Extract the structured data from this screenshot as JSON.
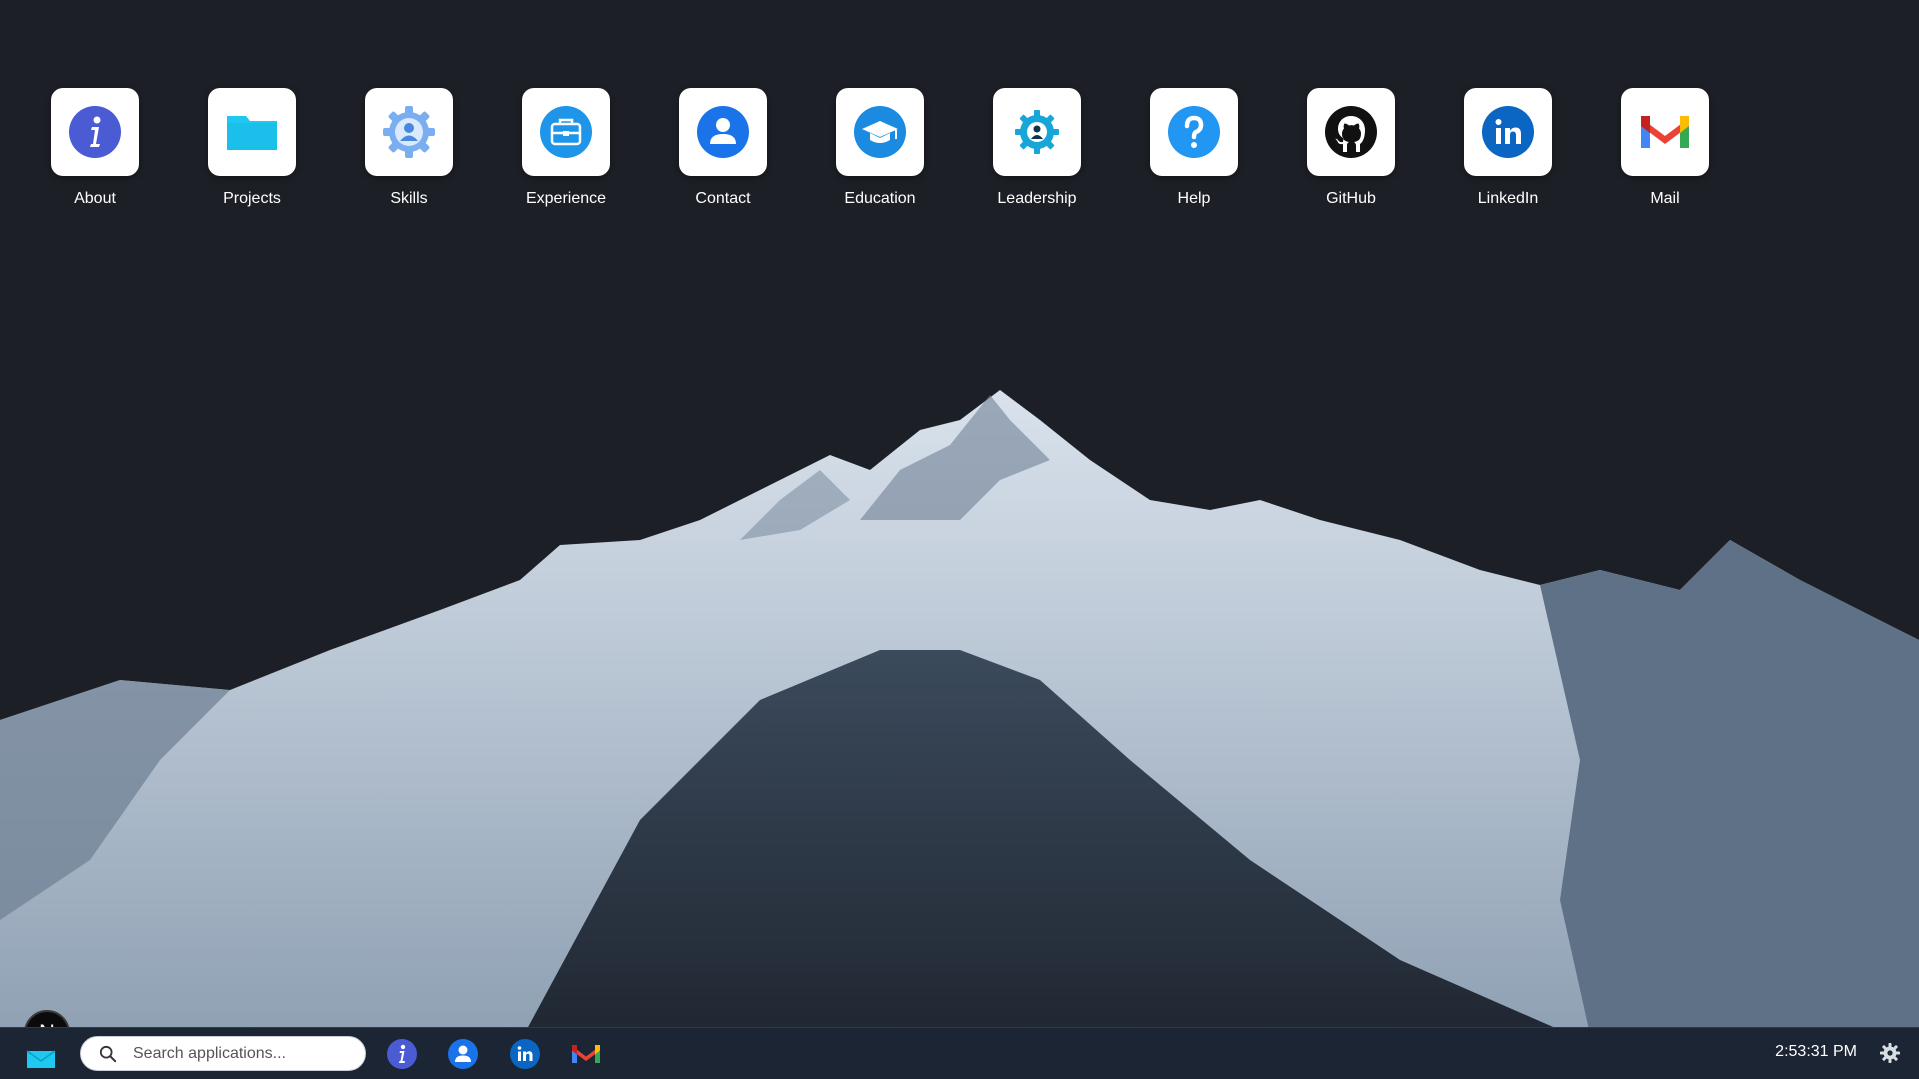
{
  "desktop": {
    "apps": [
      {
        "label": "About",
        "icon": "info-icon"
      },
      {
        "label": "Projects",
        "icon": "folder-icon"
      },
      {
        "label": "Skills",
        "icon": "gear-person-icon"
      },
      {
        "label": "Experience",
        "icon": "briefcase-icon"
      },
      {
        "label": "Contact",
        "icon": "contact-person-icon"
      },
      {
        "label": "Education",
        "icon": "graduation-cap-icon"
      },
      {
        "label": "Leadership",
        "icon": "leadership-gear-icon"
      },
      {
        "label": "Help",
        "icon": "help-question-icon"
      },
      {
        "label": "GitHub",
        "icon": "github-icon"
      },
      {
        "label": "LinkedIn",
        "icon": "linkedin-icon"
      },
      {
        "label": "Mail",
        "icon": "gmail-icon"
      }
    ]
  },
  "taskbar": {
    "avatar_letter": "N",
    "search": {
      "placeholder": "Search applications..."
    },
    "pinned": [
      "info-icon",
      "contact-person-icon",
      "linkedin-icon",
      "gmail-icon"
    ],
    "clock": "2:53:31 PM"
  },
  "colors": {
    "background": "#1c1f26",
    "taskbar": "#1b2533",
    "accent_blue": "#1a73e8",
    "folder_cyan": "#1ec8f0"
  }
}
